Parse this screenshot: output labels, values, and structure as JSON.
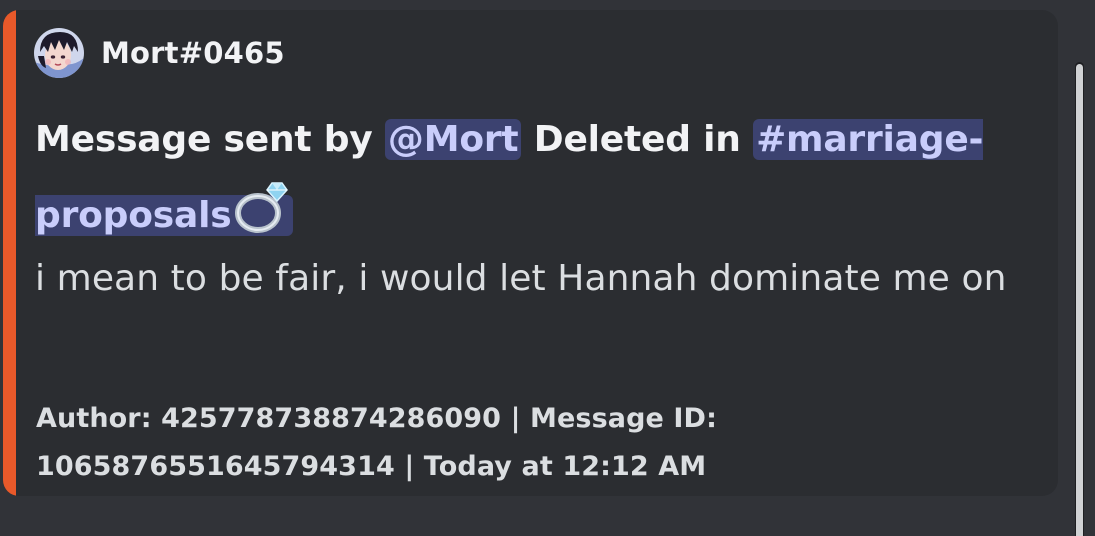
{
  "embed": {
    "accent_color": "#e8592a",
    "author": {
      "name": "Mort#0465",
      "avatar_icon": "avatar-image"
    },
    "title": {
      "prefix": "Message sent by ",
      "user_mention": "@Mort",
      "middle": " Deleted in ",
      "channel_mention": "#marriage-proposals",
      "channel_icon": "ring-icon"
    },
    "description": "i mean to be fair, i would let Hannah dominate me on",
    "footer": "Author: 425778738874286090 | Message ID: 1065876551645794314 | Today at 12:12 AM"
  },
  "colors": {
    "background": "#313338",
    "embed_background": "#2b2d31",
    "mention_background": "#3c4270",
    "mention_text": "#c9cdfb"
  }
}
